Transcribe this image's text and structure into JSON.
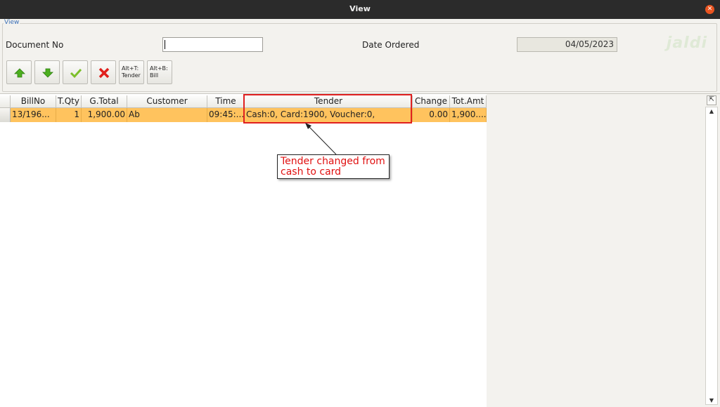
{
  "window": {
    "title": "View",
    "close_glyph": "✕"
  },
  "panel": {
    "legend": "View",
    "watermark": "jaldi",
    "document_no_label": "Document No",
    "document_no_value": "",
    "date_ordered_label": "Date Ordered",
    "date_ordered_value": "04/05/2023"
  },
  "toolbar": {
    "buttons": [
      {
        "icon": "arrow-up-icon",
        "color": "#4caf1e"
      },
      {
        "icon": "arrow-down-icon",
        "color": "#4caf1e"
      },
      {
        "icon": "checkmark-icon",
        "color": "#7cbf2a"
      },
      {
        "icon": "cross-icon",
        "color": "#e0201c"
      }
    ],
    "tender_line1": "Alt+T:",
    "tender_line2": "Tender",
    "bill_line1": "Alt+B:",
    "bill_line2": "Bill"
  },
  "table": {
    "columns": [
      "BillNo",
      "T.Qty",
      "G.Total",
      "Customer",
      "Time",
      "Tender",
      "Change",
      "Tot.Amt"
    ],
    "rows": [
      [
        "13/196...",
        "1",
        "1,900.00",
        "Ab",
        "09:45:...",
        "Cash:0, Card:1900, Voucher:0,",
        "0.00",
        "1,900...."
      ]
    ],
    "selected_row_color": "#ffc35e"
  },
  "annotation": {
    "line1": "Tender changed from",
    "line2": "cash to card",
    "color": "#e01010"
  },
  "scrollbar": {
    "corner_glyph": "⇱",
    "up_glyph": "▲",
    "down_glyph": "▼"
  }
}
